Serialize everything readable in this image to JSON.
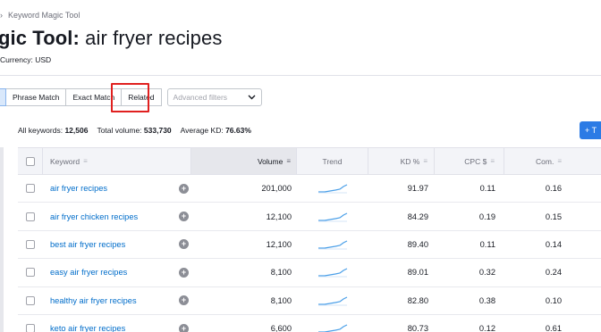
{
  "breadcrumb": {
    "current": "Keyword Magic Tool"
  },
  "header": {
    "title_prefix": "gic Tool:",
    "title_query": "air fryer recipes",
    "currency": "Currency:  USD"
  },
  "filters": {
    "tabs": [
      "Phrase Match",
      "Exact Match",
      "Related"
    ],
    "advanced_placeholder": "Advanced filters"
  },
  "stats": {
    "all_keywords_label": "All keywords:",
    "all_keywords_value": "12,506",
    "total_volume_label": "Total volume:",
    "total_volume_value": "533,730",
    "avg_kd_label": "Average KD:",
    "avg_kd_value": "76.63%"
  },
  "add_button": {
    "label": "+ T"
  },
  "table": {
    "columns": {
      "keyword": "Keyword",
      "volume": "Volume",
      "trend": "Trend",
      "kd": "KD %",
      "cpc": "CPC $",
      "com": "Com."
    },
    "rows": [
      {
        "keyword": "air fryer recipes",
        "volume": "201,000",
        "kd": "91.97",
        "cpc": "0.11",
        "com": "0.16"
      },
      {
        "keyword": "air fryer chicken recipes",
        "volume": "12,100",
        "kd": "84.29",
        "cpc": "0.19",
        "com": "0.15"
      },
      {
        "keyword": "best air fryer recipes",
        "volume": "12,100",
        "kd": "89.40",
        "cpc": "0.11",
        "com": "0.14"
      },
      {
        "keyword": "easy air fryer recipes",
        "volume": "8,100",
        "kd": "89.01",
        "cpc": "0.32",
        "com": "0.24"
      },
      {
        "keyword": "healthy air fryer recipes",
        "volume": "8,100",
        "kd": "82.80",
        "cpc": "0.38",
        "com": "0.10"
      },
      {
        "keyword": "keto air fryer recipes",
        "volume": "6,600",
        "kd": "80.73",
        "cpc": "0.12",
        "com": "0.61"
      }
    ]
  },
  "colors": {
    "accent": "#2c7be5",
    "link": "#006dca",
    "highlight": "#e0201f",
    "trend": "#4a9fe8"
  }
}
